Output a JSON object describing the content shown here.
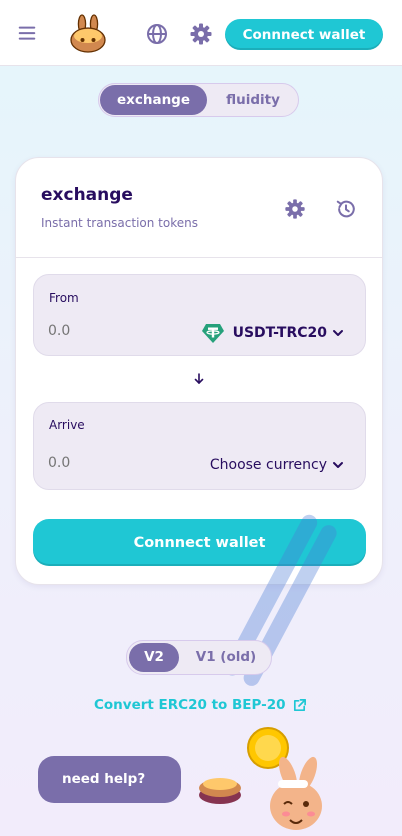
{
  "header": {
    "connect_label": "Connnect wallet"
  },
  "mode_toggle": {
    "exchange_label": "exchange",
    "fluidity_label": "fluidity"
  },
  "card": {
    "title": "exchange",
    "subtitle": "Instant transaction tokens",
    "from": {
      "label": "From",
      "amount_placeholder": "0.0",
      "token": "USDT-TRC20"
    },
    "arrive": {
      "label": "Arrive",
      "amount_placeholder": "0.0",
      "token": "Choose currency"
    },
    "connect_label": "Connnect wallet"
  },
  "version_toggle": {
    "v2_label": "V2",
    "v1_label": "V1 (old)"
  },
  "convert_link": "Convert ERC20 to BEP-20",
  "help_label": "need help?",
  "colors": {
    "primary": "#1fc7d4",
    "secondary": "#7a6eaa",
    "text": "#280d5f",
    "input_bg": "#eeeaf4",
    "tether_green": "#26a17b"
  },
  "icons": [
    "menu-icon",
    "pancake-logo",
    "globe-icon",
    "gear-icon",
    "history-icon",
    "tether-icon",
    "chevron-down-icon",
    "arrow-down-icon",
    "external-link-icon"
  ]
}
